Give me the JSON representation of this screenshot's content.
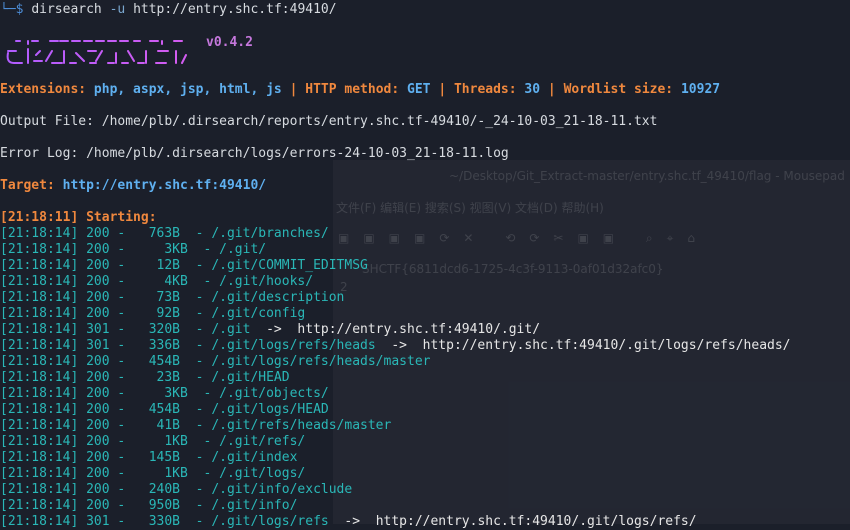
{
  "prompt": {
    "symbol": "└─$",
    "command": "dirsearch",
    "flag": "-u",
    "url": "http://entry.shc.tf:49410/"
  },
  "banner": {
    "version": "v0.4.2"
  },
  "config": {
    "ext_label": "Extensions:",
    "ext_value": "php, aspx, jsp, html, js",
    "method_label": "HTTP method:",
    "method_value": "GET",
    "threads_label": "Threads:",
    "threads_value": "30",
    "wordlist_label": "Wordlist size:",
    "wordlist_value": "10927",
    "separator": "|"
  },
  "output_file": "Output File: /home/plb/.dirsearch/reports/entry.shc.tf-49410/-_24-10-03_21-18-11.txt",
  "error_log": "Error Log: /home/plb/.dirsearch/logs/errors-24-10-03_21-18-11.log",
  "target": {
    "label": "Target:",
    "url": "http://entry.shc.tf:49410/"
  },
  "starting": "[21:18:11] Starting:",
  "results": [
    {
      "text": "[21:18:14] 200 -   763B  - /.git/branches/",
      "redirect": ""
    },
    {
      "text": "[21:18:14] 200 -     3KB  - /.git/",
      "redirect": ""
    },
    {
      "text": "[21:18:14] 200 -    12B  - /.git/COMMIT_EDITMSG",
      "redirect": ""
    },
    {
      "text": "[21:18:14] 200 -     4KB  - /.git/hooks/",
      "redirect": ""
    },
    {
      "text": "[21:18:14] 200 -    73B  - /.git/description",
      "redirect": ""
    },
    {
      "text": "[21:18:14] 200 -    92B  - /.git/config",
      "redirect": ""
    },
    {
      "text": "[21:18:14] 301 -   320B  - /.git",
      "redirect": "  ->  http://entry.shc.tf:49410/.git/"
    },
    {
      "text": "[21:18:14] 301 -   336B  - /.git/logs/refs/heads",
      "redirect": "  ->  http://entry.shc.tf:49410/.git/logs/refs/heads/"
    },
    {
      "text": "[21:18:14] 200 -   454B  - /.git/logs/refs/heads/master",
      "redirect": ""
    },
    {
      "text": "[21:18:14] 200 -    23B  - /.git/HEAD",
      "redirect": ""
    },
    {
      "text": "[21:18:14] 200 -     3KB  - /.git/objects/",
      "redirect": ""
    },
    {
      "text": "[21:18:14] 200 -   454B  - /.git/logs/HEAD",
      "redirect": ""
    },
    {
      "text": "[21:18:14] 200 -    41B  - /.git/refs/heads/master",
      "redirect": ""
    },
    {
      "text": "[21:18:14] 200 -     1KB  - /.git/refs/",
      "redirect": ""
    },
    {
      "text": "[21:18:14] 200 -   145B  - /.git/index",
      "redirect": ""
    },
    {
      "text": "[21:18:14] 200 -     1KB  - /.git/logs/",
      "redirect": ""
    },
    {
      "text": "[21:18:14] 200 -   240B  - /.git/info/exclude",
      "redirect": ""
    },
    {
      "text": "[21:18:14] 200 -   950B  - /.git/info/",
      "redirect": ""
    },
    {
      "text": "[21:18:14] 301 -   330B  - /.git/logs/refs",
      "redirect": "  ->  http://entry.shc.tf:49410/.git/logs/refs/"
    }
  ],
  "ghost_window": {
    "title": "~/Desktop/Git_Extract-master/entry.shc.tf_49410/flag - Mousepad",
    "menu": "文件(F)   编辑(E)   搜索(S)   视图(V)   文档(D)   帮助(H)",
    "content_line": "SHCTF{6811dcd6-1725-4c3f-9113-0af01d32afc0}",
    "line_no": "2"
  }
}
